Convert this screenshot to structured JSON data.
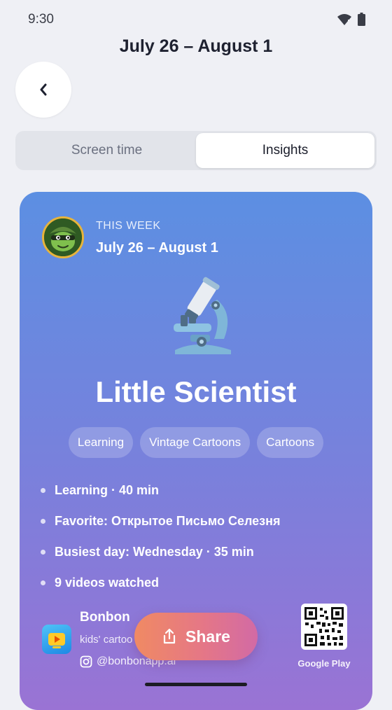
{
  "status_bar": {
    "time": "9:30"
  },
  "header": {
    "title": "July 26 – August 1",
    "back_icon": "chevron-left-icon"
  },
  "tabs": [
    {
      "label": "Screen time",
      "active": false
    },
    {
      "label": "Insights",
      "active": true
    }
  ],
  "card": {
    "week_label": "THIS WEEK",
    "week_range": "July 26 – August 1",
    "badge_icon": "microscope-icon",
    "badge_title": "Little Scientist",
    "tags": [
      "Learning",
      "Vintage Cartoons",
      "Cartoons"
    ],
    "stats": [
      "Learning · 40 min",
      "Favorite: Открытое Письмо Селезня",
      "Busiest day: Wednesday · 35 min",
      "9 videos watched"
    ],
    "brand": {
      "name": "Bonbon",
      "tagline": "kids' cartoo",
      "instagram": "@bonbonapp.ai"
    },
    "qr_caption": "Google Play"
  },
  "share_button": {
    "label": "Share",
    "icon": "share-icon"
  },
  "colors": {
    "background": "#eff0f5",
    "card_gradient_top": "#5c8fe2",
    "card_gradient_bottom": "#9a73d4",
    "share_gradient_start": "#f08a63",
    "share_gradient_end": "#d26aa5"
  }
}
